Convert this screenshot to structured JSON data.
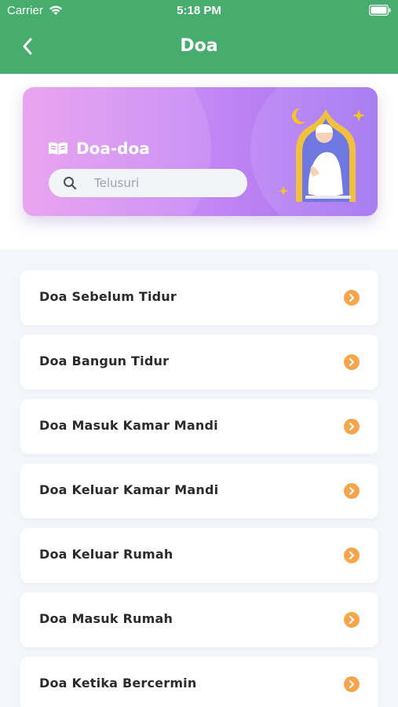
{
  "status_bar": {
    "carrier": "Carrier",
    "time": "5:18 PM"
  },
  "nav": {
    "title": "Doa",
    "back_icon": "chevron-left-icon"
  },
  "hero": {
    "title": "Doa-doa",
    "title_icon": "book-open-icon",
    "search_placeholder": "Telusuri",
    "search_value": ""
  },
  "list": {
    "items": [
      {
        "label": "Doa Sebelum Tidur"
      },
      {
        "label": "Doa Bangun Tidur"
      },
      {
        "label": "Doa Masuk Kamar Mandi"
      },
      {
        "label": "Doa Keluar Kamar Mandi"
      },
      {
        "label": "Doa Keluar Rumah"
      },
      {
        "label": "Doa Masuk Rumah"
      },
      {
        "label": "Doa Ketika Bercermin"
      }
    ]
  },
  "colors": {
    "header_green": "#46ad6e",
    "accent_orange": "#f5a64c",
    "card_purple": "#9f70f2",
    "card_pink": "#e79bee"
  }
}
